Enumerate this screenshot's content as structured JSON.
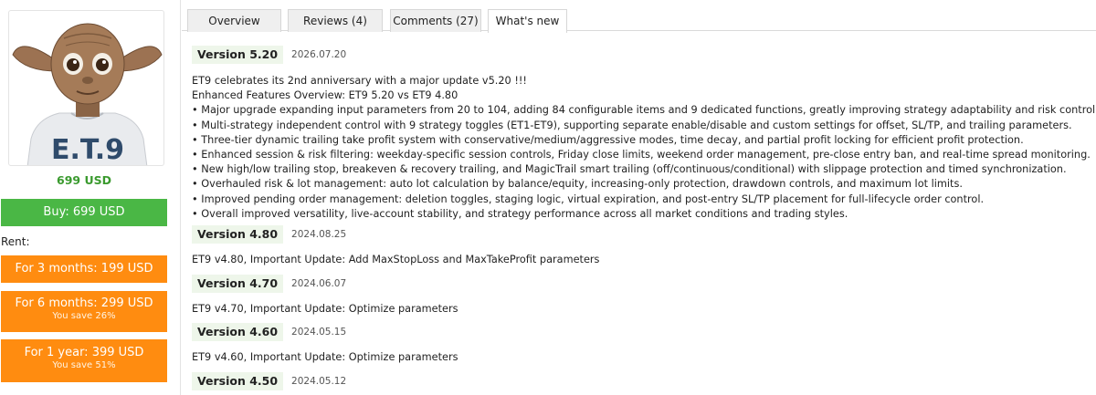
{
  "sidebar": {
    "price": "699 USD",
    "buy_label": "Buy: 699 USD",
    "rent_label": "Rent:",
    "rent_options": [
      {
        "label": "For 3 months: 199 USD",
        "save": ""
      },
      {
        "label": "For 6 months: 299 USD",
        "save": "You save 26%"
      },
      {
        "label": "For 1 year: 399 USD",
        "save": "You save 51%"
      }
    ]
  },
  "tabs": [
    {
      "label": "Overview",
      "active": false
    },
    {
      "label": "Reviews (4)",
      "active": false
    },
    {
      "label": "Comments (27)",
      "active": false
    },
    {
      "label": "What's new",
      "active": true
    }
  ],
  "versions": [
    {
      "label": "Version 5.20",
      "date": "2026.07.20",
      "lines": [
        "ET9 celebrates its 2nd anniversary with a major update v5.20 !!!",
        "Enhanced Features Overview: ET9 5.20 vs ET9 4.80",
        "• Major upgrade expanding input parameters from 20 to 104, adding 84 configurable items and 9 dedicated functions, greatly improving strategy adaptability and risk control precision.",
        "• Multi-strategy independent control with 9 strategy toggles (ET1-ET9), supporting separate enable/disable and custom settings for offset, SL/TP, and trailing parameters.",
        "• Three-tier dynamic trailing take profit system with conservative/medium/aggressive modes, time decay, and partial profit locking for efficient profit protection.",
        "• Enhanced session & risk filtering: weekday-specific session controls, Friday close limits, weekend order management, pre-close entry ban, and real-time spread monitoring.",
        "• New high/low trailing stop, breakeven & recovery trailing, and MagicTrail smart trailing (off/continuous/conditional) with slippage protection and timed synchronization.",
        "• Overhauled risk & lot management: auto lot calculation by balance/equity, increasing-only protection, drawdown controls, and maximum lot limits.",
        "• Improved pending order management: deletion toggles, staging logic, virtual expiration, and post-entry SL/TP placement for full-lifecycle order control.",
        "• Overall improved versatility, live-account stability, and strategy performance across all market conditions and trading styles."
      ]
    },
    {
      "label": "Version 4.80",
      "date": "2024.08.25",
      "lines": [
        "ET9 v4.80, Important Update: Add MaxStopLoss and MaxTakeProfit parameters"
      ]
    },
    {
      "label": "Version 4.70",
      "date": "2024.06.07",
      "lines": [
        "ET9 v4.70, Important Update: Optimize parameters"
      ]
    },
    {
      "label": "Version 4.60",
      "date": "2024.05.15",
      "lines": [
        "ET9 v4.60, Important Update: Optimize parameters"
      ]
    },
    {
      "label": "Version 4.50",
      "date": "2024.05.12",
      "lines": []
    }
  ],
  "logo_text": "E.T.9"
}
